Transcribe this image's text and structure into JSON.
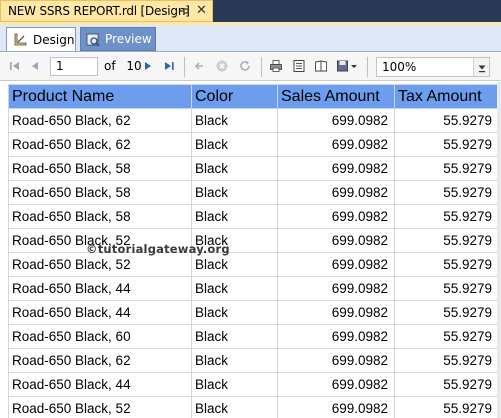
{
  "document_tab": {
    "title": "NEW SSRS REPORT.rdl [Design]"
  },
  "view_tabs": [
    {
      "label": "Design",
      "active": true,
      "icon": "design-ruler-icon"
    },
    {
      "label": "Preview",
      "active": false,
      "icon": "preview-icon"
    }
  ],
  "toolbar": {
    "current_page": "1",
    "of_label": "of",
    "total_pages": "10",
    "zoom": "100%"
  },
  "table": {
    "columns": [
      "Product Name",
      "Color",
      "Sales Amount",
      "Tax Amount"
    ],
    "rows": [
      [
        "Road-650 Black, 62",
        "Black",
        "699.0982",
        "55.9279"
      ],
      [
        "Road-650 Black, 62",
        "Black",
        "699.0982",
        "55.9279"
      ],
      [
        "Road-650 Black, 58",
        "Black",
        "699.0982",
        "55.9279"
      ],
      [
        "Road-650 Black, 58",
        "Black",
        "699.0982",
        "55.9279"
      ],
      [
        "Road-650 Black, 58",
        "Black",
        "699.0982",
        "55.9279"
      ],
      [
        "Road-650 Black, 52",
        "Black",
        "699.0982",
        "55.9279"
      ],
      [
        "Road-650 Black, 52",
        "Black",
        "699.0982",
        "55.9279"
      ],
      [
        "Road-650 Black, 44",
        "Black",
        "699.0982",
        "55.9279"
      ],
      [
        "Road-650 Black, 44",
        "Black",
        "699.0982",
        "55.9279"
      ],
      [
        "Road-650 Black, 60",
        "Black",
        "699.0982",
        "55.9279"
      ],
      [
        "Road-650 Black, 62",
        "Black",
        "699.0982",
        "55.9279"
      ],
      [
        "Road-650 Black, 44",
        "Black",
        "699.0982",
        "55.9279"
      ],
      [
        "Road-650 Black, 52",
        "Black",
        "699.0982",
        "55.9279"
      ]
    ]
  },
  "watermark": "©tutorialgateway.org",
  "colors": {
    "header_fill": "#6d9ded",
    "doc_tab_active": "#ffe8a6",
    "preview_tab": "#6e91c7",
    "ide_background": "#293955"
  }
}
